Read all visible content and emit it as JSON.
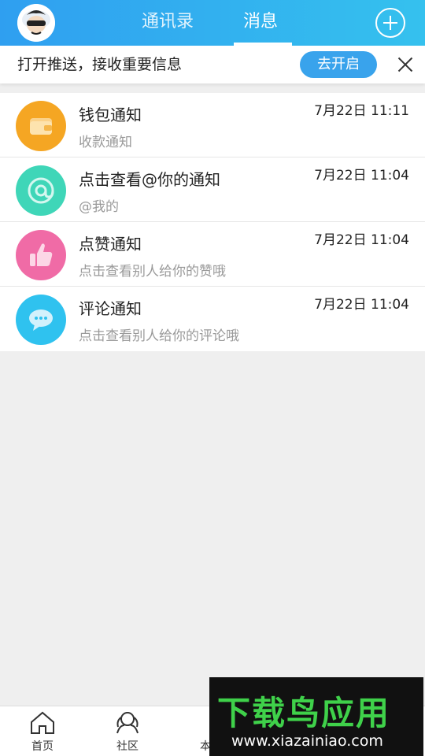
{
  "header": {
    "tabs": [
      "通讯录",
      "消息"
    ],
    "active_tab": "消息",
    "add_icon": "plus-circle-icon",
    "avatar_icon": "cartoon-avatar-icon"
  },
  "banner": {
    "text": "打开推送，接收重要信息",
    "button_label": "去开启",
    "close_icon": "close-icon"
  },
  "messages": [
    {
      "title": "钱包通知",
      "subtitle": "收款通知",
      "time": "7月22日 11:11",
      "icon": "wallet-icon",
      "color": "#f5a623"
    },
    {
      "title": "点击查看@你的通知",
      "subtitle": "@我的",
      "time": "7月22日 11:04",
      "icon": "at-icon",
      "color": "#3fd6b8"
    },
    {
      "title": "点赞通知",
      "subtitle": "点击查看别人给你的赞哦",
      "time": "7月22日 11:04",
      "icon": "thumbs-up-icon",
      "color": "#f06ba6"
    },
    {
      "title": "评论通知",
      "subtitle": "点击查看别人给你的评论哦",
      "time": "7月22日 11:04",
      "icon": "comment-icon",
      "color": "#2fc2ef"
    }
  ],
  "bottom_nav": [
    {
      "label": "首页",
      "icon": "home-icon"
    },
    {
      "label": "社区",
      "icon": "community-icon"
    },
    {
      "label": "本",
      "icon": "local-icon"
    }
  ],
  "watermark": {
    "main": "下载鸟应用",
    "url": "www.xiazainiao.com"
  },
  "colors": {
    "header_start": "#2f9ff0",
    "header_end": "#35c1ee",
    "accent_button": "#39a3ec"
  }
}
